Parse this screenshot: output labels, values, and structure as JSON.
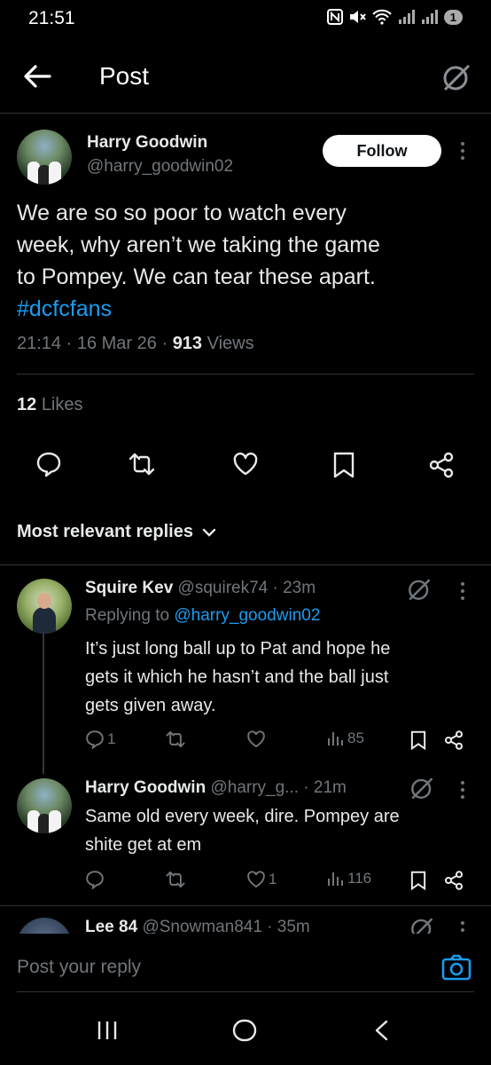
{
  "status_bar": {
    "time": "21:51",
    "badge": "1"
  },
  "header": {
    "title": "Post"
  },
  "post": {
    "author_name": "Harry Goodwin",
    "author_handle": "@harry_goodwin02",
    "follow_label": "Follow",
    "text_lines": [
      "We are so so poor to watch every",
      "week, why aren’t we taking the game",
      "to Pompey. We can tear these apart."
    ],
    "hashtag": "#dcfcfans",
    "time": "21:14",
    "date": "16 Mar 26",
    "views_count": "913",
    "views_label": "Views",
    "likes_count": "12",
    "likes_label": "Likes"
  },
  "replies_sort_label": "Most relevant replies",
  "replies": [
    {
      "name": "Squire Kev",
      "handle_time": "@squirek74 · 23m",
      "replying_prefix": "Replying to",
      "replying_to": "@harry_goodwin02",
      "text_lines": [
        "It’s just long ball up to Pat and hope he",
        "gets it which he hasn’t and the ball just",
        "gets given away."
      ],
      "reply_count": "1",
      "like_count": "",
      "view_count": "85"
    },
    {
      "name": "Harry Goodwin",
      "handle_time": "@harry_g... · 21m",
      "text_lines": [
        "Same old every week, dire. Pompey are",
        "shite get at em"
      ],
      "reply_count": "",
      "like_count": "1",
      "view_count": "116"
    },
    {
      "name": "Lee 84",
      "handle_time": "@Snowman841 · 35m"
    }
  ],
  "reply_box": {
    "placeholder": "Post your reply"
  },
  "colors": {
    "accent": "#1d9bf0",
    "muted": "#71767b",
    "text": "#e7e9ea",
    "background": "#000000"
  }
}
